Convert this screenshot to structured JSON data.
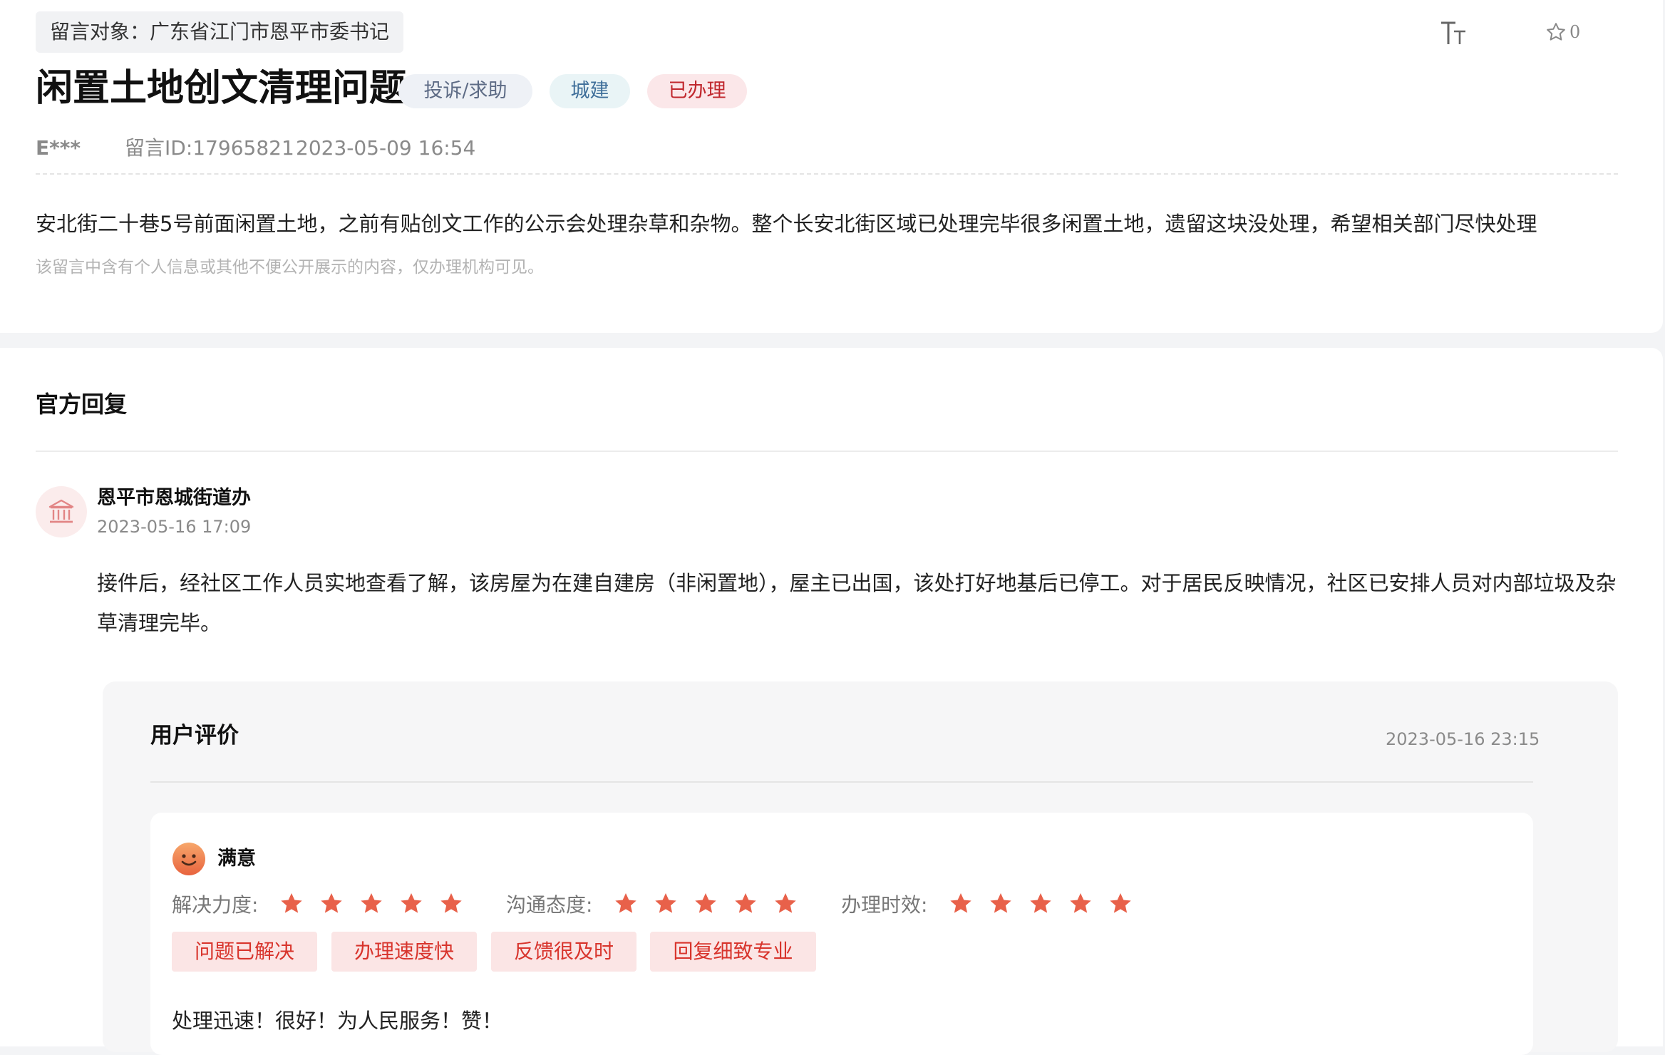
{
  "message": {
    "target": "留言对象：广东省江门市恩平市委书记",
    "title": "闲置土地创文清理问题",
    "tags": {
      "type": "投诉/求助",
      "category": "城建",
      "status": "已办理"
    },
    "favorite_count": "0",
    "author": "E***",
    "message_id": "留言ID:17965821",
    "time": "2023-05-09 16:54",
    "content": "安北街二十巷5号前面闲置土地，之前有贴创文工作的公示会处理杂草和杂物。整个长安北街区域已处理完毕很多闲置土地，遗留这块没处理，希望相关部门尽快处理",
    "notice": "该留言中含有个人信息或其他不便公开展示的内容，仅办理机构可见。"
  },
  "reply": {
    "section_title": "官方回复",
    "org_name": "恩平市恩城街道办",
    "time": "2023-05-16 17:09",
    "content": "接件后，经社区工作人员实地查看了解，该房屋为在建自建房（非闲置地），屋主已出国，该处打好地基后已停工。对于居民反映情况，社区已安排人员对内部垃圾及杂草清理完毕。"
  },
  "evaluation": {
    "title": "用户评价",
    "time": "2023-05-16 23:15",
    "rating_label": "满意",
    "metrics": [
      {
        "label": "解决力度:",
        "stars": 5
      },
      {
        "label": "沟通态度:",
        "stars": 5
      },
      {
        "label": "办理时效:",
        "stars": 5
      }
    ],
    "chips": [
      "问题已解决",
      "办理速度快",
      "反馈很及时",
      "回复细致专业"
    ],
    "comment": "处理迅速！很好！为人民服务！赞！"
  },
  "icons": {
    "font_size": "font-size-icon",
    "favorite": "star-outline-icon",
    "org": "government-building-icon",
    "rating": "smile-face-icon",
    "metric_star": "filled-star-icon"
  },
  "colors": {
    "status_red": "#c0272d",
    "chip_bg": "#fbe5e5",
    "chip_text": "#d8342c",
    "star": "#e8614a",
    "type_tag_bg": "#eef1f6",
    "category_tag_bg": "#e9f4f6",
    "status_tag_bg": "#fbe7e9"
  }
}
